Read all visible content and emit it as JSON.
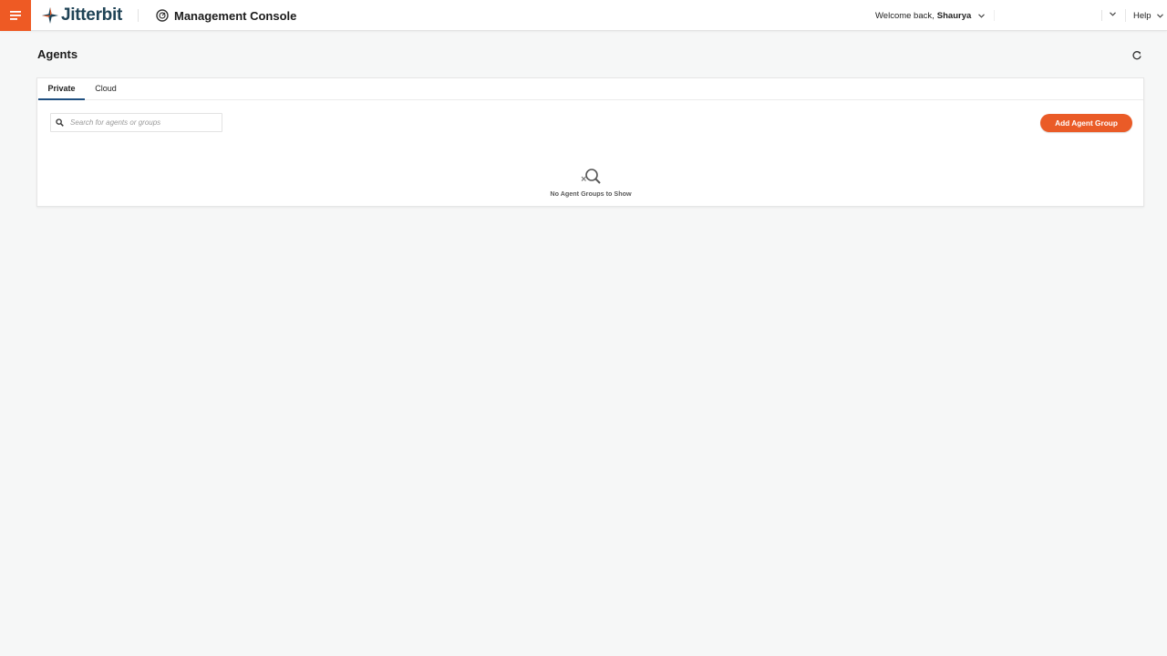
{
  "header": {
    "brand": "Jitterbit",
    "app_title": "Management Console",
    "welcome_prefix": "Welcome back,",
    "username": "Shaurya",
    "help_label": "Help",
    "accent_color": "#ee5a24",
    "icons": {
      "menu": "hamburger-menu-icon",
      "logo": "jitterbit-logo-icon",
      "console": "management-console-icon",
      "dropdown": "chevron-down-icon"
    }
  },
  "page": {
    "title": "Agents",
    "refresh_icon": "refresh-icon"
  },
  "tabs": [
    {
      "label": "Private",
      "active": true
    },
    {
      "label": "Cloud",
      "active": false
    }
  ],
  "search": {
    "placeholder": "Search for agents or groups",
    "value": "",
    "icon": "search-icon"
  },
  "actions": {
    "add_agent_group_label": "Add Agent Group",
    "button_color": "#ea5b27"
  },
  "empty_state": {
    "icon": "no-results-search-icon",
    "message": "No Agent Groups to Show"
  }
}
